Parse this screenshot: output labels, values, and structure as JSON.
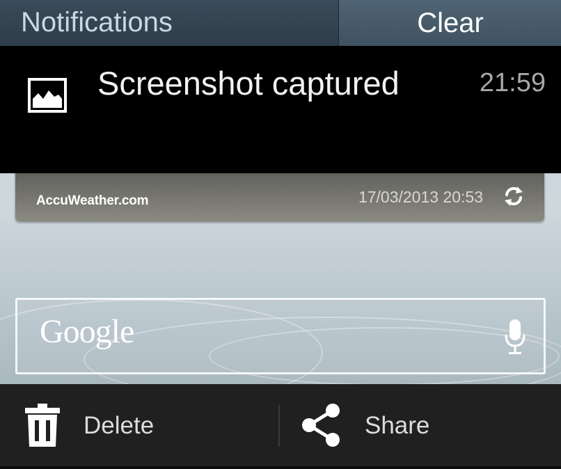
{
  "header": {
    "title": "Notifications",
    "clear_label": "Clear"
  },
  "notification": {
    "icon": "image-icon",
    "title": "Screenshot captured",
    "time": "21:59"
  },
  "weather_widget": {
    "brand": "AccuWeather.com",
    "updated": "17/03/2013 20:53",
    "refresh_icon": "refresh-icon"
  },
  "search_widget": {
    "logo": "Google",
    "mic_icon": "microphone-icon"
  },
  "actions": {
    "delete_label": "Delete",
    "delete_icon": "trash-icon",
    "share_label": "Share",
    "share_icon": "share-icon"
  },
  "colors": {
    "header_bg": "#2e3d49",
    "clear_bg": "#4f6474",
    "notification_bg": "#000000",
    "action_bar_bg": "#202020"
  }
}
